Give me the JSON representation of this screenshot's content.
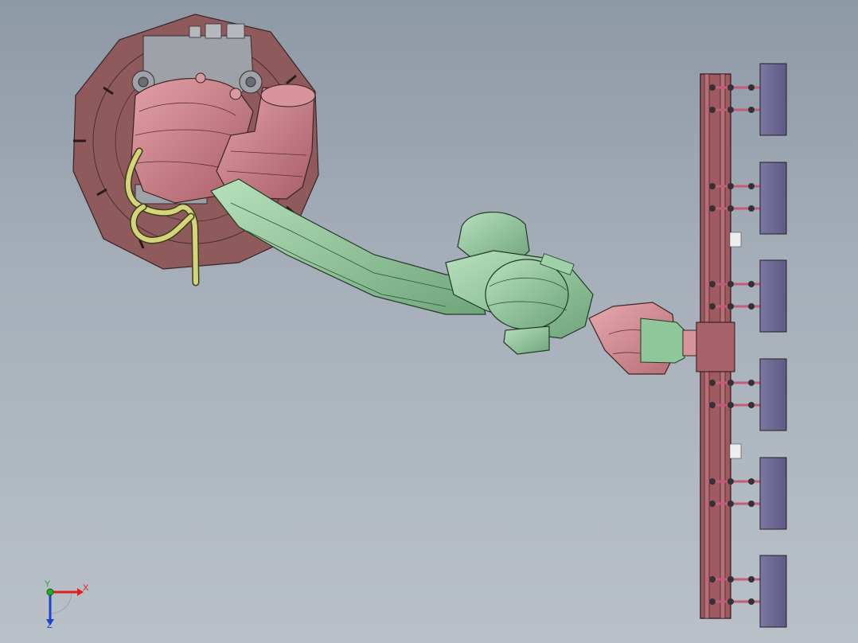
{
  "viewport": {
    "background_top": "#8e99a6",
    "background_bottom": "#b9c0c8"
  },
  "colors": {
    "base_pink": "#b96e73",
    "base_disk": "#8f5a5c",
    "arm_green": "#8fc79a",
    "wrist_pink": "#c47a80",
    "hose_yellow": "#d4d57a",
    "plate_maroon": "#9e5a60",
    "pad_purple": "#6d6895",
    "bracket_grey": "#9ea2a8"
  },
  "triad": {
    "x_label": "X",
    "y_label": "Y",
    "z_label": "Z",
    "x_color": "#e02020",
    "y_color": "#20b020",
    "z_color": "#2040d0"
  },
  "gripper": {
    "pad_count": 6
  }
}
